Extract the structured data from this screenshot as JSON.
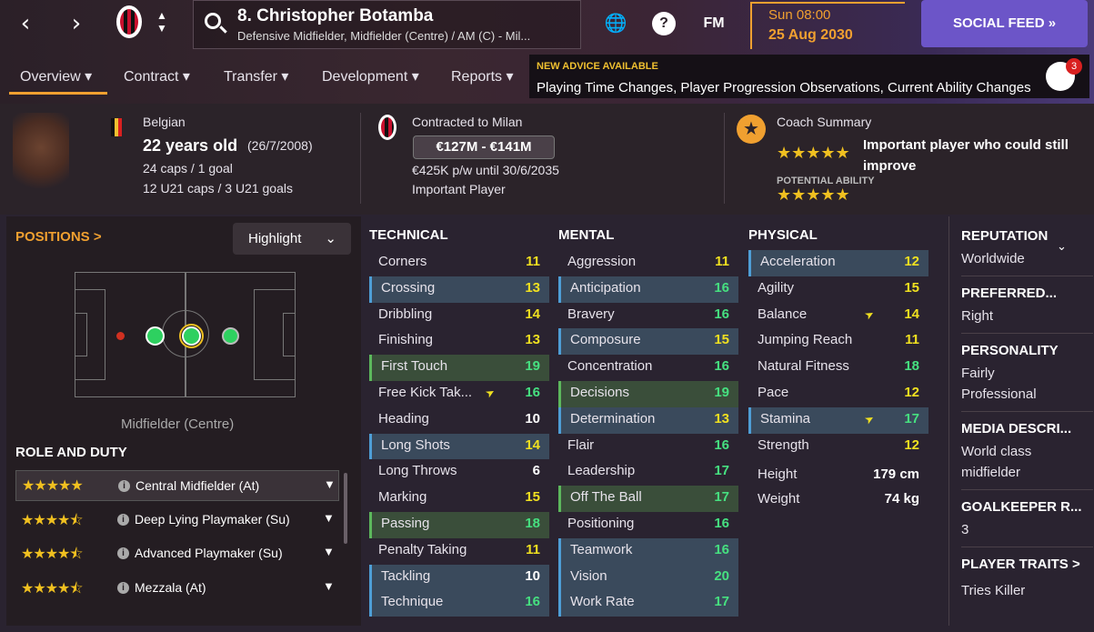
{
  "header": {
    "player_name": "8. Christopher Botamba",
    "player_positions": "Defensive Midfielder, Midfielder (Centre) / AM (C) - Mil...",
    "date_day": "Sun 08:00",
    "date_full": "25 Aug 2030",
    "social_label": "SOCIAL FEED",
    "help_label": "?",
    "fm_label": "FM"
  },
  "tabs": [
    "Overview",
    "Contract",
    "Transfer",
    "Development",
    "Reports"
  ],
  "advice": {
    "title": "NEW ADVICE AVAILABLE",
    "body": "Playing Time Changes, Player Progression Observations, Current Ability Changes",
    "count": "3"
  },
  "info": {
    "nationality": "Belgian",
    "age": "22 years old",
    "dob": "(26/7/2008)",
    "caps": "24 caps / 1 goal",
    "u21": "12 U21 caps / 3 U21 goals",
    "contract_club": "Contracted to Milan",
    "value": "€127M - €141M",
    "wage": "€425K p/w until 30/6/2035",
    "status": "Important Player",
    "coach_summary_label": "Coach Summary",
    "coach_summary": "Important player who could still improve",
    "potential_label": "POTENTIAL ABILITY",
    "current_stars": "★★★★★",
    "potential_stars": "★★★★★"
  },
  "left": {
    "positions_label": "POSITIONS >",
    "highlight_label": "Highlight",
    "position_name": "Midfielder (Centre)",
    "role_duty_label": "ROLE AND DUTY",
    "roles": [
      {
        "stars": "★★★★★",
        "label": "Central Midfielder (At)"
      },
      {
        "stars": "★★★★⯪",
        "label": "Deep Lying Playmaker (Su)"
      },
      {
        "stars": "★★★★⯪",
        "label": "Advanced Playmaker (Su)"
      },
      {
        "stars": "★★★★⯪",
        "label": "Mezzala (At)"
      }
    ]
  },
  "attributes": {
    "technical_label": "TECHNICAL",
    "mental_label": "MENTAL",
    "physical_label": "PHYSICAL",
    "technical": [
      {
        "name": "Corners",
        "value": "11"
      },
      {
        "name": "Crossing",
        "value": "13"
      },
      {
        "name": "Dribbling",
        "value": "14"
      },
      {
        "name": "Finishing",
        "value": "13"
      },
      {
        "name": "First Touch",
        "value": "19"
      },
      {
        "name": "Free Kick Tak...",
        "value": "16"
      },
      {
        "name": "Heading",
        "value": "10"
      },
      {
        "name": "Long Shots",
        "value": "14"
      },
      {
        "name": "Long Throws",
        "value": "6"
      },
      {
        "name": "Marking",
        "value": "15"
      },
      {
        "name": "Passing",
        "value": "18"
      },
      {
        "name": "Penalty Taking",
        "value": "11"
      },
      {
        "name": "Tackling",
        "value": "10"
      },
      {
        "name": "Technique",
        "value": "16"
      }
    ],
    "mental": [
      {
        "name": "Aggression",
        "value": "11"
      },
      {
        "name": "Anticipation",
        "value": "16"
      },
      {
        "name": "Bravery",
        "value": "16"
      },
      {
        "name": "Composure",
        "value": "15"
      },
      {
        "name": "Concentration",
        "value": "16"
      },
      {
        "name": "Decisions",
        "value": "19"
      },
      {
        "name": "Determination",
        "value": "13"
      },
      {
        "name": "Flair",
        "value": "16"
      },
      {
        "name": "Leadership",
        "value": "17"
      },
      {
        "name": "Off The Ball",
        "value": "17"
      },
      {
        "name": "Positioning",
        "value": "16"
      },
      {
        "name": "Teamwork",
        "value": "16"
      },
      {
        "name": "Vision",
        "value": "20"
      },
      {
        "name": "Work Rate",
        "value": "17"
      }
    ],
    "physical": [
      {
        "name": "Acceleration",
        "value": "12"
      },
      {
        "name": "Agility",
        "value": "15"
      },
      {
        "name": "Balance",
        "value": "14"
      },
      {
        "name": "Jumping Reach",
        "value": "11"
      },
      {
        "name": "Natural Fitness",
        "value": "18"
      },
      {
        "name": "Pace",
        "value": "12"
      },
      {
        "name": "Stamina",
        "value": "17"
      },
      {
        "name": "Strength",
        "value": "12"
      }
    ],
    "height_label": "Height",
    "height": "179 cm",
    "weight_label": "Weight",
    "weight": "74 kg"
  },
  "right": {
    "reputation_label": "REPUTATION",
    "reputation": "Worldwide",
    "foot_label": "PREFERRED...",
    "foot": "Right",
    "personality_label": "PERSONALITY",
    "personality": "Fairly Professional",
    "media_label": "MEDIA DESCRI...",
    "media": "World class midfielder",
    "gk_label": "GOALKEEPER R...",
    "gk": "3",
    "traits_label": "PLAYER TRAITS >",
    "traits": "Tries Killer"
  }
}
